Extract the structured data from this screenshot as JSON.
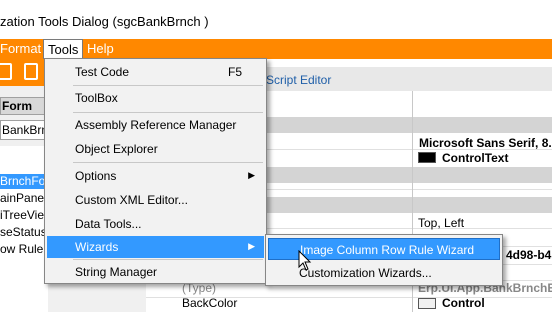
{
  "window": {
    "title": "zation Tools Dialog  (sgcBankBrnch )"
  },
  "menubar": {
    "format": "Format",
    "tools": "Tools",
    "help": "Help"
  },
  "left_panel": {
    "header": "Form",
    "field_value": "BankBrnch",
    "tree_items": [
      "BrnchFor",
      "ainPanel",
      "iTreeVie",
      "seStatus",
      "ow Rule"
    ]
  },
  "editor": {
    "tab_label": "Script Editor",
    "values": {
      "font": "Microsoft Sans Serif, 8.",
      "forecolor": "ControlText",
      "anchor": "Top, Left",
      "guid": "4d98-b4",
      "type_label": "(Type)",
      "type_value": "Erp.UI.App.BankBrnchE",
      "backcolor_label": "BackColor",
      "backcolor_value": "Control"
    },
    "colors": {
      "controltext": "#000000",
      "control": "#f0f0f0"
    }
  },
  "tools_menu": {
    "items": [
      {
        "label": "Test Code",
        "shortcut": "F5"
      },
      {
        "label": "ToolBox"
      },
      {
        "label": "Assembly Reference Manager"
      },
      {
        "label": "Object Explorer"
      },
      {
        "label": "Options",
        "submenu": true
      },
      {
        "label": "Custom XML Editor..."
      },
      {
        "label": "Data Tools..."
      },
      {
        "label": "Wizards",
        "submenu": true,
        "highlighted": true
      },
      {
        "label": "String Manager"
      }
    ]
  },
  "wizards_submenu": {
    "items": [
      {
        "label": "Image Column Row Rule Wizard",
        "highlighted": true
      },
      {
        "label": "Customization Wizards..."
      }
    ]
  },
  "colors": {
    "accent": "#ff8800",
    "highlight": "#3399ff"
  }
}
